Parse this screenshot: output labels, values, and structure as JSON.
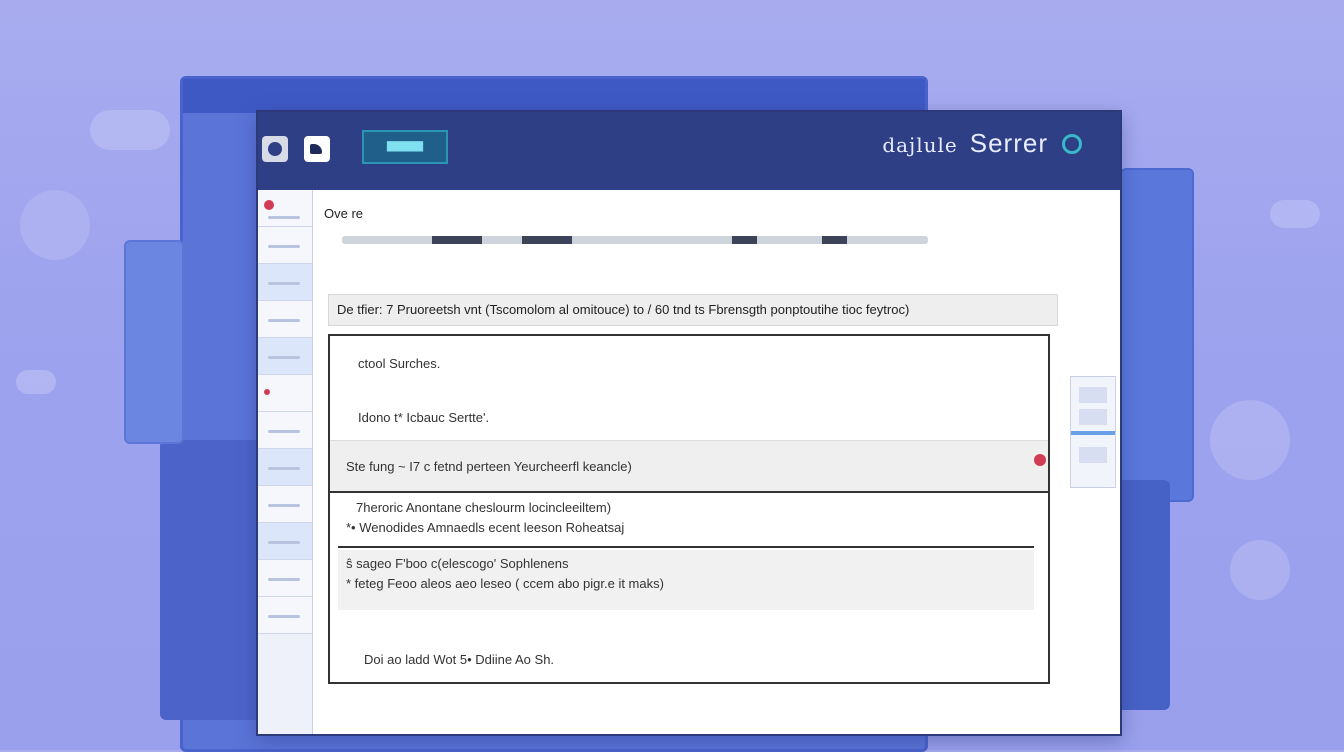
{
  "window": {
    "badge_text": "▇▇▇▇▇▇",
    "title_prefix": "dajlule",
    "title": "Serrer"
  },
  "content": {
    "heading": "Ove re",
    "progress_fill": 0.85,
    "infobar": "De tfier: 7 Pruoreetsh vnt (Tscomolom al omitouce) to / 60 tnd ts Fbrensgth ponptoutihe tioc feytroc)",
    "rows": [
      {
        "text": "ctool Surches."
      },
      {
        "text": "Idono t* Icbauc Sertte'."
      },
      {
        "text": "Ste fung ~ I7 c fetnd perteen Yeurcheerfl keancle)"
      }
    ],
    "blocks": [
      {
        "line1": "7heroric Anontane cheslourm locincleeiltem)",
        "line2": "*• Wenodides Amnaedls ecent leeson Roheatsaj"
      },
      {
        "line1": "ŝ sageo F'boo c(elescogo' Sophlenens",
        "line2": "* feteg Feoo aleos aeo leseo ( ccem abo pigr.e it maks)"
      }
    ],
    "footer": "Doi ao ladd Wot 5• Ddiine Ao Sh."
  },
  "colors": {
    "titlebar": "#2f3f86",
    "accent_ring": "#38b8c8",
    "alert_dot": "#d23b55"
  },
  "icons": [
    "window-control-icon",
    "app-icon",
    "status-ring-icon",
    "alert-dot-icon"
  ]
}
